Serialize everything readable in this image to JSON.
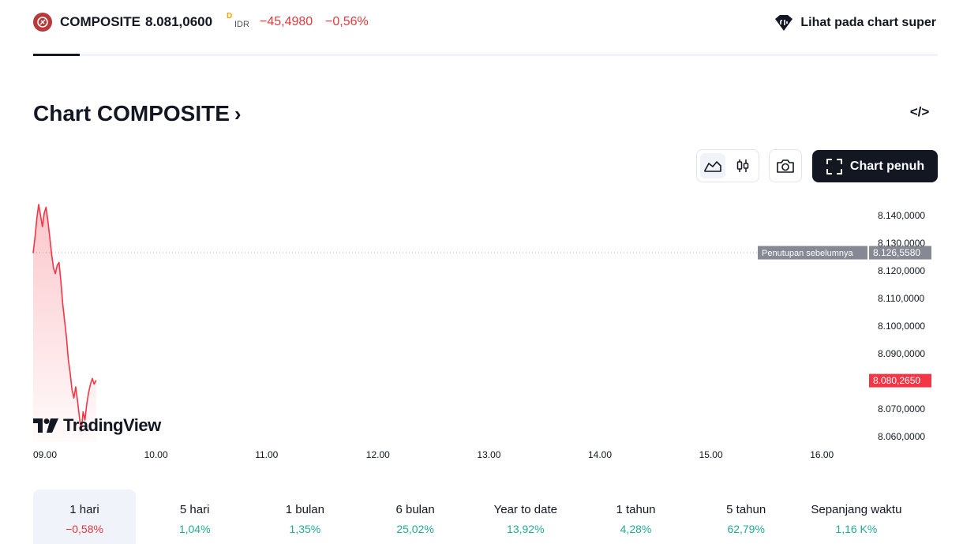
{
  "header": {
    "symbol": "COMPOSITE",
    "price": "8.081,0600",
    "delay_badge": "D",
    "currency": "IDR",
    "change": "−45,4980",
    "change_pct": "−0,56%",
    "super_chart_link": "Lihat pada chart super"
  },
  "section": {
    "title": "Chart COMPOSITE",
    "title_chevron": "›",
    "embed_label": "</>"
  },
  "toolbar": {
    "fullscreen_label": "Chart penuh",
    "active_chart_style": "area"
  },
  "colors": {
    "down": "#e03a3e",
    "up": "#22ab94",
    "area_line": "#f23645",
    "prev_close_badge": "#868993"
  },
  "branding": {
    "watermark": "TradingView"
  },
  "chart_data": {
    "type": "area",
    "x_unit": "time of day",
    "ylim": [
      8058,
      8146
    ],
    "xlim": [
      "09:00",
      "16:30"
    ],
    "grid": false,
    "y_ticks": [
      "8.140,0000",
      "8.130,0000",
      "8.120,0000",
      "8.110,0000",
      "8.100,0000",
      "8.090,0000",
      "8.080,0000",
      "8.070,0000",
      "8.060,0000"
    ],
    "y_tick_values": [
      8140,
      8130,
      8120,
      8110,
      8100,
      8090,
      8080,
      8070,
      8060
    ],
    "x_ticks": [
      "09.00",
      "10.00",
      "11.00",
      "12.00",
      "13.00",
      "14.00",
      "15.00",
      "16.00"
    ],
    "x_tick_values": [
      "09:00",
      "10:00",
      "11:00",
      "12:00",
      "13:00",
      "14:00",
      "15:00",
      "16:00"
    ],
    "prev_close": {
      "label": "Penutupan sebelumnya",
      "value_text": "8.126,5580",
      "value": 8126.558
    },
    "last": {
      "value_text": "8.080,2650",
      "value": 8080.265
    },
    "series": [
      {
        "points": [
          [
            "09:00",
            8126.5
          ],
          [
            "09:01",
            8132
          ],
          [
            "09:02",
            8139
          ],
          [
            "09:03",
            8144
          ],
          [
            "09:04",
            8140
          ],
          [
            "09:05",
            8136
          ],
          [
            "09:06",
            8141
          ],
          [
            "09:07",
            8143
          ],
          [
            "09:08",
            8138
          ],
          [
            "09:09",
            8132
          ],
          [
            "09:10",
            8126
          ],
          [
            "09:11",
            8121
          ],
          [
            "09:12",
            8119
          ],
          [
            "09:13",
            8122
          ],
          [
            "09:14",
            8123
          ],
          [
            "09:15",
            8116
          ],
          [
            "09:16",
            8108
          ],
          [
            "09:17",
            8102
          ],
          [
            "09:18",
            8096
          ],
          [
            "09:19",
            8088
          ],
          [
            "09:20",
            8083
          ],
          [
            "09:21",
            8077
          ],
          [
            "09:22",
            8074
          ],
          [
            "09:23",
            8078
          ],
          [
            "09:24",
            8073
          ],
          [
            "09:25",
            8067
          ],
          [
            "09:26",
            8062
          ],
          [
            "09:27",
            8069
          ],
          [
            "09:28",
            8066
          ],
          [
            "09:29",
            8072
          ],
          [
            "09:30",
            8076
          ],
          [
            "09:31",
            8079
          ],
          [
            "09:32",
            8081
          ],
          [
            "09:33",
            8079
          ],
          [
            "09:34",
            8080.3
          ]
        ]
      }
    ]
  },
  "periods": [
    {
      "label": "1 hari",
      "value": "−0,58%",
      "trend": "down",
      "active": true
    },
    {
      "label": "5 hari",
      "value": "1,04%",
      "trend": "up",
      "active": false
    },
    {
      "label": "1 bulan",
      "value": "1,35%",
      "trend": "up",
      "active": false
    },
    {
      "label": "6 bulan",
      "value": "25,02%",
      "trend": "up",
      "active": false
    },
    {
      "label": "Year to date",
      "value": "13,92%",
      "trend": "up",
      "active": false
    },
    {
      "label": "1 tahun",
      "value": "4,28%",
      "trend": "up",
      "active": false
    },
    {
      "label": "5 tahun",
      "value": "62,79%",
      "trend": "up",
      "active": false
    },
    {
      "label": "Sepanjang waktu",
      "value": "1,16 K%",
      "trend": "up",
      "active": false
    }
  ]
}
